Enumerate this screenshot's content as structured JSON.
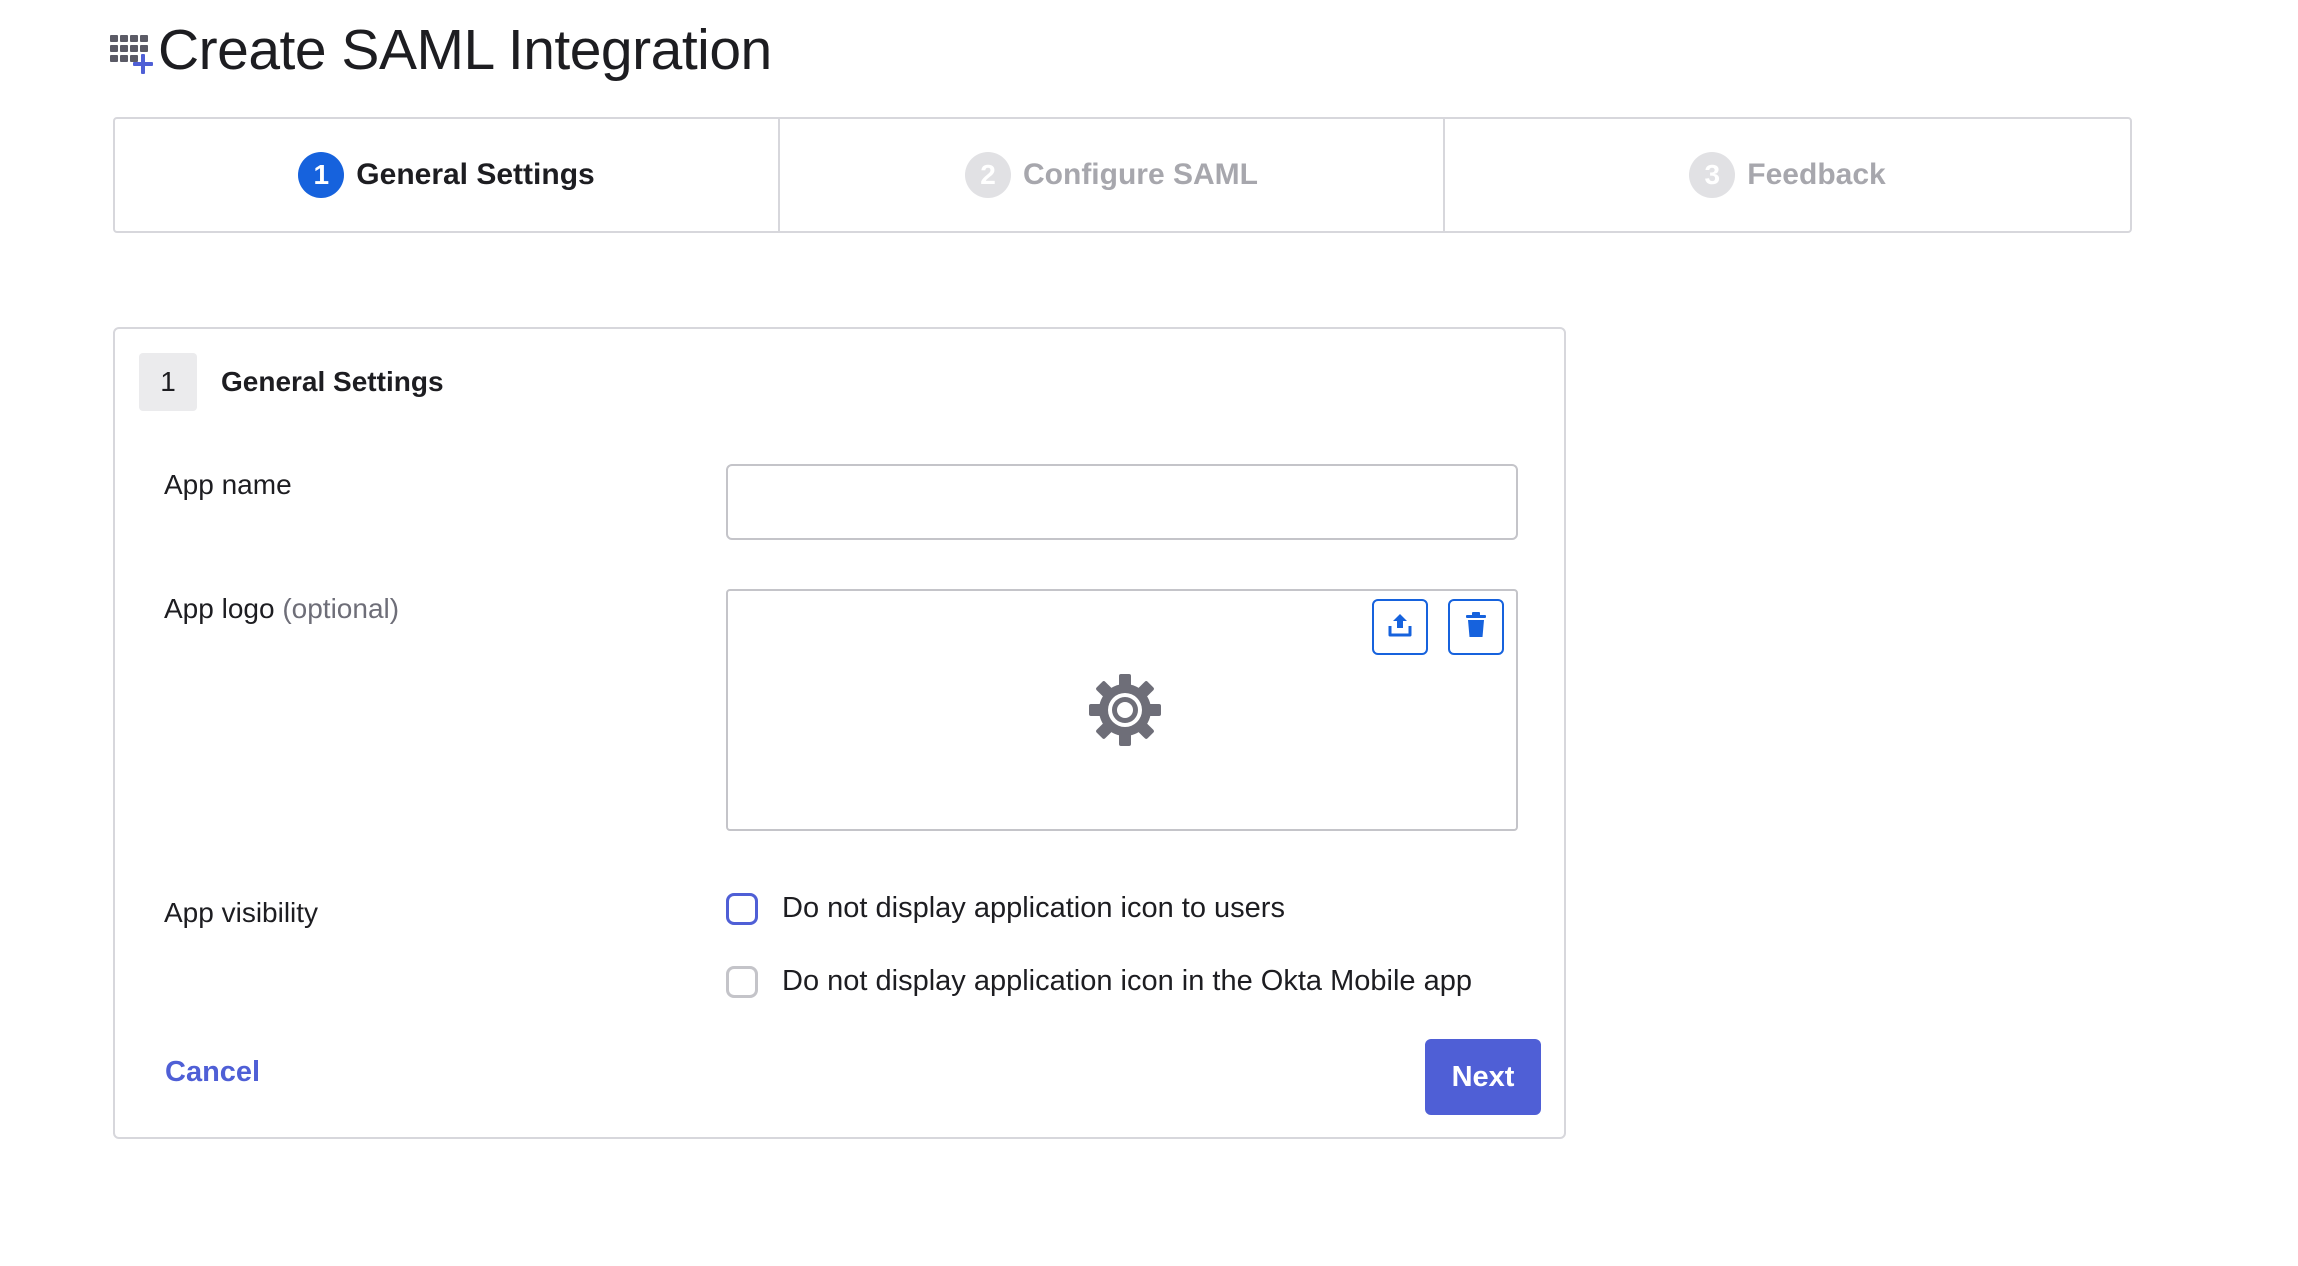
{
  "page": {
    "title": "Create SAML Integration"
  },
  "stepper": {
    "steps": [
      {
        "number": "1",
        "label": "General Settings",
        "state": "active"
      },
      {
        "number": "2",
        "label": "Configure SAML",
        "state": "inactive"
      },
      {
        "number": "3",
        "label": "Feedback",
        "state": "inactive"
      }
    ]
  },
  "card": {
    "step_number": "1",
    "title": "General Settings",
    "app_name": {
      "label": "App name",
      "value": "",
      "placeholder": ""
    },
    "app_logo": {
      "label": "App logo",
      "optional_text": "(optional)",
      "upload_icon": "upload-icon",
      "delete_icon": "trash-icon",
      "placeholder_icon": "gear-icon"
    },
    "app_visibility": {
      "label": "App visibility",
      "options": [
        {
          "label": "Do not display application icon to users",
          "checked": false
        },
        {
          "label": "Do not display application icon in the Okta Mobile app",
          "checked": false
        }
      ]
    },
    "cancel_label": "Cancel",
    "next_label": "Next"
  },
  "colors": {
    "primary": "#4f5fd6",
    "step_active": "#1662dd",
    "step_inactive": "#e1e1e4",
    "border": "#d7d7dc"
  }
}
